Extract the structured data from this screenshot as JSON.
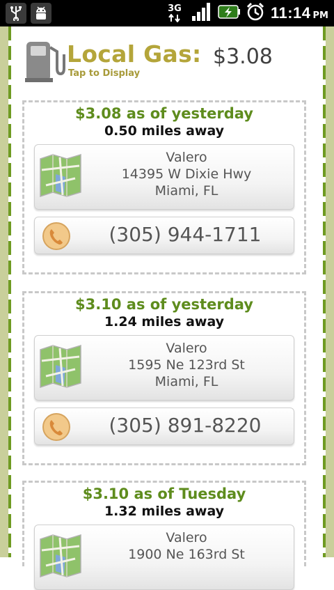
{
  "status_bar": {
    "time": "11:14",
    "ampm": "PM",
    "network": "3G"
  },
  "header": {
    "brand": "Local Gas:",
    "subtitle": "Tap to Display",
    "price": "$3.08"
  },
  "stations": [
    {
      "price_line": "$3.08 as of yesterday",
      "distance": "0.50 miles away",
      "name": "Valero",
      "street": "14395 W Dixie Hwy",
      "city": "Miami, FL",
      "phone": "(305) 944-1711"
    },
    {
      "price_line": "$3.10 as of yesterday",
      "distance": "1.24 miles away",
      "name": "Valero",
      "street": "1595 Ne 123rd St",
      "city": "Miami, FL",
      "phone": "(305) 891-8220"
    },
    {
      "price_line": "$3.10 as of Tuesday",
      "distance": "1.32 miles away",
      "name": "Valero",
      "street": "1900 Ne 163rd St"
    }
  ],
  "colors": {
    "price_green": "#5e8c1d",
    "brand_gold": "#b4a53a",
    "border_green": "#6f9b22"
  }
}
